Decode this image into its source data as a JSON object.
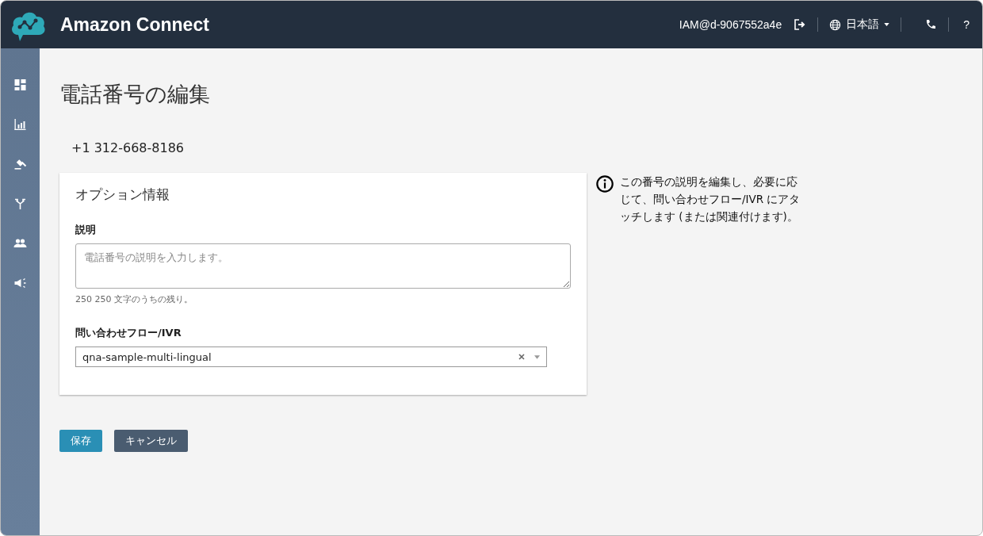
{
  "header": {
    "title": "Amazon Connect",
    "user": "IAM@d-9067552a4e",
    "language": "日本語",
    "help": "?"
  },
  "page": {
    "title": "電話番号の編集",
    "phone_number": "+1 312-668-8186"
  },
  "card": {
    "title": "オプション情報",
    "description": {
      "label": "説明",
      "placeholder": "電話番号の説明を入力します。",
      "hint": "250 250 文字のうちの残り。"
    },
    "flow": {
      "label": "問い合わせフロー/IVR",
      "value": "qna-sample-multi-lingual"
    }
  },
  "info": "この番号の説明を編集し、必要に応じて、問い合わせフロー/IVR にアタッチします (または関連付けます)。",
  "buttons": [
    {
      "label": "保存",
      "kind": "primary"
    },
    {
      "label": "キャンセル",
      "kind": "secondary"
    }
  ]
}
